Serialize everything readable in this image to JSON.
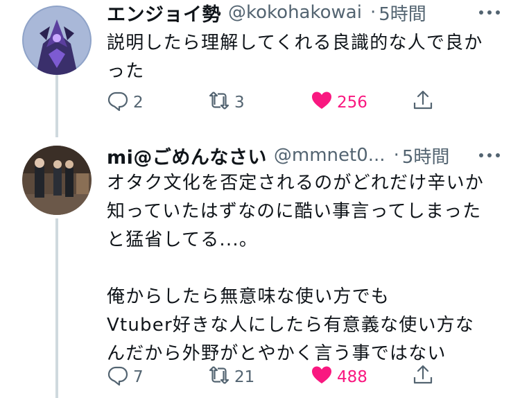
{
  "tweets": [
    {
      "display_name": "エンジョイ勢",
      "handle": "@kokohakowai",
      "separator": "·",
      "time": "5時間",
      "lines": [
        "説明したら理解してくれる良識的な人で良か",
        "った"
      ],
      "replies": "2",
      "retweets": "3",
      "likes": "256",
      "liked": true
    },
    {
      "display_name": "mi@ごめんなさい",
      "handle": "@mmnet0...",
      "separator": "·",
      "time": "5時間",
      "lines": [
        "オタク文化を否定されるのがどれだけ辛いか",
        "知っていたはずなのに酷い事言ってしまった",
        "と猛省してる...。",
        "",
        "俺からしたら無意味な使い方でも",
        "Vtuber好きな人にしたら有意義な使い方な",
        "んだから外野がとやかく言う事ではない"
      ],
      "replies": "7",
      "retweets": "21",
      "likes": "488",
      "liked": true
    }
  ],
  "colors": {
    "like": "#f91880",
    "secondary_text": "#536471",
    "thread_line": "#cfd9de"
  },
  "icons": {
    "reply": "reply-icon",
    "retweet": "retweet-icon",
    "like": "heart-icon",
    "share": "share-icon",
    "more": "more-icon"
  }
}
